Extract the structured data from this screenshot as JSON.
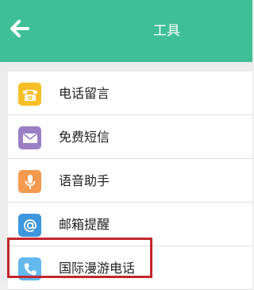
{
  "header": {
    "title": "工具",
    "back_icon": "back-arrow-icon",
    "background": "#3fbf96"
  },
  "list": {
    "items": [
      {
        "label": "电话留言",
        "icon": "voicemail-phone-icon",
        "icon_color": "#f6bf26"
      },
      {
        "label": "免费短信",
        "icon": "envelope-icon",
        "icon_color": "#9b7fc4"
      },
      {
        "label": "语音助手",
        "icon": "microphone-icon",
        "icon_color": "#f39a4f"
      },
      {
        "label": "邮箱提醒",
        "icon": "at-sign-icon",
        "icon_color": "#3e96dc"
      },
      {
        "label": "国际漫游电话",
        "icon": "phone-handset-icon",
        "icon_color": "#63b8ee"
      }
    ]
  },
  "highlight_color": "#c2272d"
}
